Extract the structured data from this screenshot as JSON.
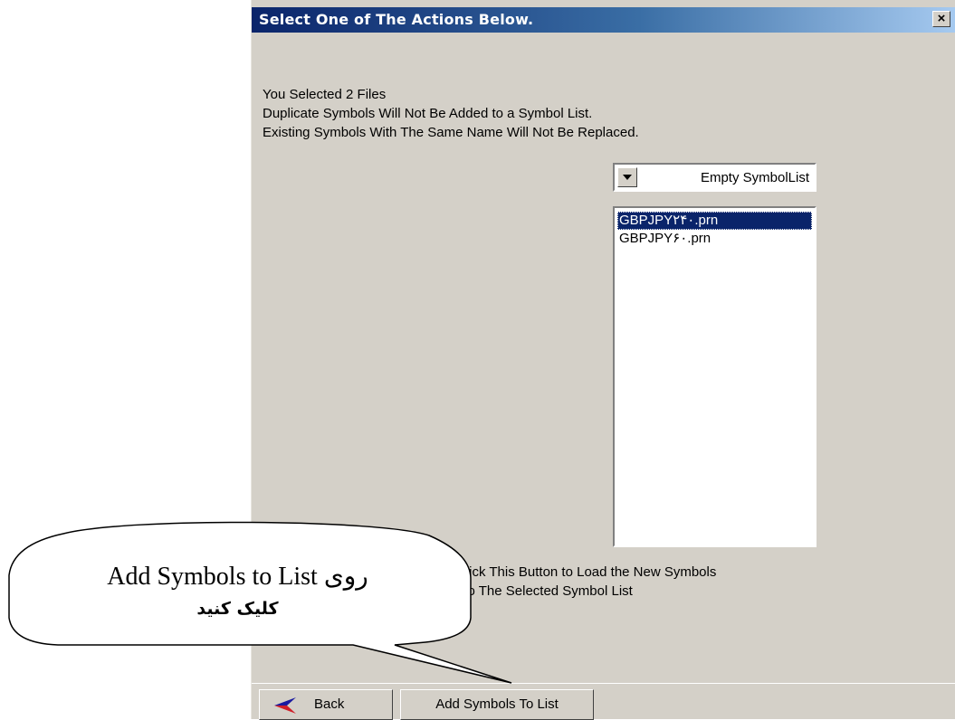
{
  "dialog": {
    "title": "Select One of The Actions Below.",
    "close_glyph": "×",
    "info_lines": [
      "You Selected 2 Files",
      "Duplicate Symbols Will Not Be Added to a Symbol List.",
      "Existing Symbols With The Same Name Will Not Be Replaced."
    ],
    "combo": {
      "selected": "Empty SymbolList"
    },
    "files": [
      {
        "label": "GBPJPY۲۴۰.prn",
        "selected": true
      },
      {
        "label": "GBPJPY۶۰.prn",
        "selected": false
      }
    ],
    "hint_lines": [
      "Click This Button to Load the New Symbols",
      "nto The Selected Symbol List"
    ],
    "buttons": {
      "back": "Back",
      "add": "Add Symbols To List"
    }
  },
  "callout": {
    "line1_en": "Add Symbols to List",
    "line1_fa": "روی",
    "line2_fa": "کلیک کنید"
  }
}
